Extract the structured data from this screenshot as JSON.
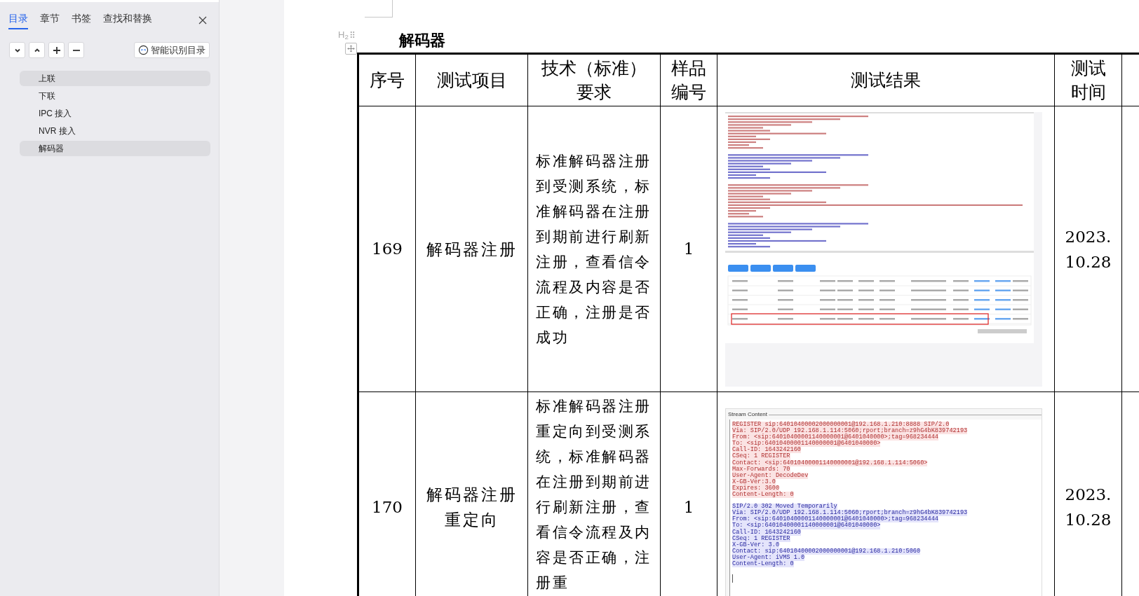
{
  "sidebar": {
    "tabs": [
      {
        "label": "目录",
        "selected": true
      },
      {
        "label": "章节",
        "selected": false
      },
      {
        "label": "书签",
        "selected": false
      },
      {
        "label": "查找和替换",
        "selected": false
      }
    ],
    "smart_button": "智能识别目录",
    "outline": [
      {
        "label": "上联",
        "selected": true
      },
      {
        "label": "下联",
        "selected": false
      },
      {
        "label": "IPC 接入",
        "selected": false
      },
      {
        "label": "NVR 接入",
        "selected": false
      },
      {
        "label": "解码器",
        "selected": true
      }
    ]
  },
  "document": {
    "heading_marker": "H$_{2}$",
    "heading": "解码器",
    "table": {
      "columns": [
        "序号",
        "测试项目",
        "技术（标准）要求",
        "样品编号",
        "测试结果",
        "测试时间"
      ],
      "rows": [
        {
          "number": "169",
          "item": "解码器注册",
          "requirement": "标准解码器注册到受测系统，标准解码器在注册到期前进行刷新注册，查看信令流程及内容是否正确，注册是否成功",
          "sample": "1",
          "result": {
            "kind": "capture"
          },
          "date": "2023.10.28"
        },
        {
          "number": "170",
          "item": "解码器注册重定向",
          "requirement": "标准解码器注册重定向到受测系统，标准解码器在注册到期前进行刷新注册，查看信令流程及内容是否正确，注册重",
          "sample": "1",
          "result": {
            "kind": "stream",
            "title": "Stream Content",
            "messages": [
              {
                "kind": "request",
                "lines": [
                  "REGISTER sip:64010400002000000001@192.168.1.210:8888 SIP/2.0",
                  "Via: SIP/2.0/UDP 192.168.1.114:5060;rport;branch=z9hG4bK839742193",
                  "From: <sip:64010400001140000001@6401040000>;tag=968234444",
                  "To: <sip:64010400001140000001@6401040000>",
                  "Call-ID: 1643242160",
                  "CSeq: 1 REGISTER",
                  "Contact: <sip:64010400001140000001@192.168.1.114:5060>",
                  "Max-Forwards: 70",
                  "User-Agent: DecodeDev",
                  "X-GB-Ver:3.0",
                  "Expires: 3600",
                  "Content-Length: 0"
                ]
              },
              {
                "kind": "response",
                "lines": [
                  "SIP/2.0 302 Moved Temporarily",
                  "Via: SIP/2.0/UDP 192.168.1.114:5060;rport;branch=z9hG4bK839742193",
                  "From: <sip:64010400001140000001@6401040000>;tag=968234444",
                  "To: <sip:64010400001140000001@6401040000>",
                  "Call-ID: 1643242160",
                  "CSeq: 1 REGISTER",
                  "X-GB-Ver: 3.0",
                  "Contact: sip:64010400002000000001@192.168.1.210:5060",
                  "User-Agent: iVMS 1.0",
                  "Content-Length: 0"
                ]
              }
            ]
          },
          "date": "2023.10.28"
        }
      ]
    }
  }
}
